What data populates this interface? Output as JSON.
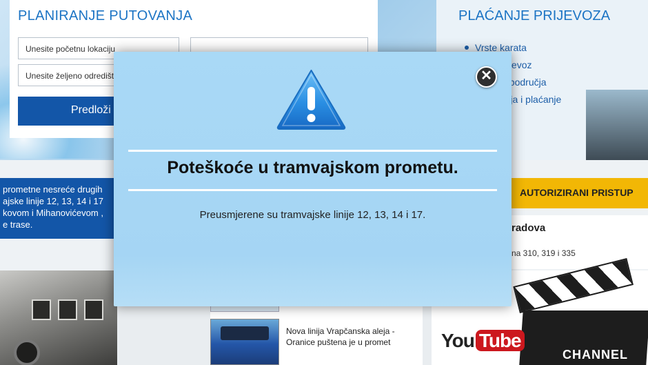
{
  "planner": {
    "title": "PLANIRANJE PUTOVANJA",
    "start_placeholder": "Unesite početnu lokaciju",
    "dest_placeholder": "Unesite željeno odredište",
    "right_placeholder": "",
    "submit_label": "Predloži op"
  },
  "payment": {
    "title": "PLAĆANJE PRIJEVOZA",
    "items": [
      {
        "label": "Vrste karata"
      },
      {
        "label": "latan prijevoz"
      },
      {
        "label": "i tarifna područja"
      },
      {
        "label": "e, prodaja i plaćanje"
      }
    ]
  },
  "news_blue": {
    "lines": [
      "prometne nesreće drugih",
      "ajske linije 12, 13, 14 i 17",
      "kovom i Mihanovićevom ,",
      "e trase."
    ]
  },
  "auth_bar": {
    "label": "AUTORIZIRANI PRISTUP"
  },
  "right_panel": {
    "heading": "radova",
    "text": "na 310, 319 i 335"
  },
  "news_item": {
    "text": "Nova linija Vrapčanska aleja - Oranice puštena je u promet"
  },
  "youtube": {
    "you": "You",
    "tube": "Tube",
    "channel": "CHANNEL"
  },
  "modal": {
    "close_icon": "close-icon",
    "warning_icon": "warning-triangle-icon",
    "title": "Poteškoće u tramvajskom prometu.",
    "body": "Preusmjerene su tramvajske linije 12, 13, 14 i 17.",
    "colors": {
      "background": "#a9d9f6",
      "icon": "#1e88e5",
      "rule": "#ffffff"
    }
  }
}
